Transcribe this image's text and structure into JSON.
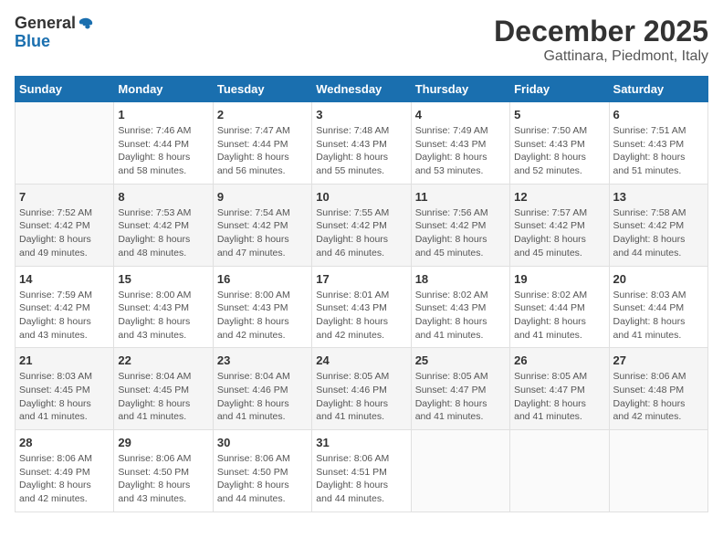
{
  "logo": {
    "general": "General",
    "blue": "Blue"
  },
  "title": "December 2025",
  "location": "Gattinara, Piedmont, Italy",
  "weekdays": [
    "Sunday",
    "Monday",
    "Tuesday",
    "Wednesday",
    "Thursday",
    "Friday",
    "Saturday"
  ],
  "weeks": [
    [
      {
        "day": "",
        "info": ""
      },
      {
        "day": "1",
        "info": "Sunrise: 7:46 AM\nSunset: 4:44 PM\nDaylight: 8 hours\nand 58 minutes."
      },
      {
        "day": "2",
        "info": "Sunrise: 7:47 AM\nSunset: 4:44 PM\nDaylight: 8 hours\nand 56 minutes."
      },
      {
        "day": "3",
        "info": "Sunrise: 7:48 AM\nSunset: 4:43 PM\nDaylight: 8 hours\nand 55 minutes."
      },
      {
        "day": "4",
        "info": "Sunrise: 7:49 AM\nSunset: 4:43 PM\nDaylight: 8 hours\nand 53 minutes."
      },
      {
        "day": "5",
        "info": "Sunrise: 7:50 AM\nSunset: 4:43 PM\nDaylight: 8 hours\nand 52 minutes."
      },
      {
        "day": "6",
        "info": "Sunrise: 7:51 AM\nSunset: 4:43 PM\nDaylight: 8 hours\nand 51 minutes."
      }
    ],
    [
      {
        "day": "7",
        "info": "Sunrise: 7:52 AM\nSunset: 4:42 PM\nDaylight: 8 hours\nand 49 minutes."
      },
      {
        "day": "8",
        "info": "Sunrise: 7:53 AM\nSunset: 4:42 PM\nDaylight: 8 hours\nand 48 minutes."
      },
      {
        "day": "9",
        "info": "Sunrise: 7:54 AM\nSunset: 4:42 PM\nDaylight: 8 hours\nand 47 minutes."
      },
      {
        "day": "10",
        "info": "Sunrise: 7:55 AM\nSunset: 4:42 PM\nDaylight: 8 hours\nand 46 minutes."
      },
      {
        "day": "11",
        "info": "Sunrise: 7:56 AM\nSunset: 4:42 PM\nDaylight: 8 hours\nand 45 minutes."
      },
      {
        "day": "12",
        "info": "Sunrise: 7:57 AM\nSunset: 4:42 PM\nDaylight: 8 hours\nand 45 minutes."
      },
      {
        "day": "13",
        "info": "Sunrise: 7:58 AM\nSunset: 4:42 PM\nDaylight: 8 hours\nand 44 minutes."
      }
    ],
    [
      {
        "day": "14",
        "info": "Sunrise: 7:59 AM\nSunset: 4:42 PM\nDaylight: 8 hours\nand 43 minutes."
      },
      {
        "day": "15",
        "info": "Sunrise: 8:00 AM\nSunset: 4:43 PM\nDaylight: 8 hours\nand 43 minutes."
      },
      {
        "day": "16",
        "info": "Sunrise: 8:00 AM\nSunset: 4:43 PM\nDaylight: 8 hours\nand 42 minutes."
      },
      {
        "day": "17",
        "info": "Sunrise: 8:01 AM\nSunset: 4:43 PM\nDaylight: 8 hours\nand 42 minutes."
      },
      {
        "day": "18",
        "info": "Sunrise: 8:02 AM\nSunset: 4:43 PM\nDaylight: 8 hours\nand 41 minutes."
      },
      {
        "day": "19",
        "info": "Sunrise: 8:02 AM\nSunset: 4:44 PM\nDaylight: 8 hours\nand 41 minutes."
      },
      {
        "day": "20",
        "info": "Sunrise: 8:03 AM\nSunset: 4:44 PM\nDaylight: 8 hours\nand 41 minutes."
      }
    ],
    [
      {
        "day": "21",
        "info": "Sunrise: 8:03 AM\nSunset: 4:45 PM\nDaylight: 8 hours\nand 41 minutes."
      },
      {
        "day": "22",
        "info": "Sunrise: 8:04 AM\nSunset: 4:45 PM\nDaylight: 8 hours\nand 41 minutes."
      },
      {
        "day": "23",
        "info": "Sunrise: 8:04 AM\nSunset: 4:46 PM\nDaylight: 8 hours\nand 41 minutes."
      },
      {
        "day": "24",
        "info": "Sunrise: 8:05 AM\nSunset: 4:46 PM\nDaylight: 8 hours\nand 41 minutes."
      },
      {
        "day": "25",
        "info": "Sunrise: 8:05 AM\nSunset: 4:47 PM\nDaylight: 8 hours\nand 41 minutes."
      },
      {
        "day": "26",
        "info": "Sunrise: 8:05 AM\nSunset: 4:47 PM\nDaylight: 8 hours\nand 41 minutes."
      },
      {
        "day": "27",
        "info": "Sunrise: 8:06 AM\nSunset: 4:48 PM\nDaylight: 8 hours\nand 42 minutes."
      }
    ],
    [
      {
        "day": "28",
        "info": "Sunrise: 8:06 AM\nSunset: 4:49 PM\nDaylight: 8 hours\nand 42 minutes."
      },
      {
        "day": "29",
        "info": "Sunrise: 8:06 AM\nSunset: 4:50 PM\nDaylight: 8 hours\nand 43 minutes."
      },
      {
        "day": "30",
        "info": "Sunrise: 8:06 AM\nSunset: 4:50 PM\nDaylight: 8 hours\nand 44 minutes."
      },
      {
        "day": "31",
        "info": "Sunrise: 8:06 AM\nSunset: 4:51 PM\nDaylight: 8 hours\nand 44 minutes."
      },
      {
        "day": "",
        "info": ""
      },
      {
        "day": "",
        "info": ""
      },
      {
        "day": "",
        "info": ""
      }
    ]
  ]
}
